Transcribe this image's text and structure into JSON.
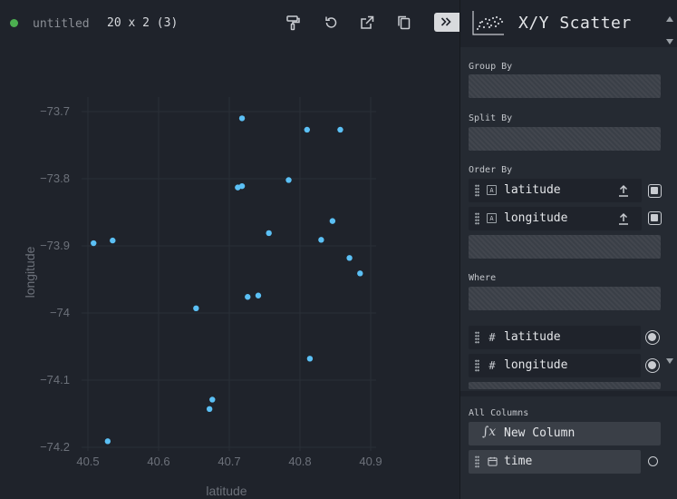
{
  "toolbar": {
    "title": "untitled",
    "dimensions": "20 x 2 (3)",
    "icons": [
      "paint-roller-icon",
      "undo-icon",
      "export-icon",
      "copy-icon",
      "collapse-panel-icon"
    ],
    "status_color": "#4caf50"
  },
  "panel": {
    "chart_type_label": "X/Y Scatter",
    "group_by_label": "Group By",
    "split_by_label": "Split By",
    "order_by_label": "Order By",
    "order_by_items": [
      {
        "label": "latitude",
        "type_glyph": "A"
      },
      {
        "label": "longitude",
        "type_glyph": "A"
      }
    ],
    "where_label": "Where",
    "columns": [
      {
        "label": "latitude",
        "type_glyph": "#"
      },
      {
        "label": "longitude",
        "type_glyph": "#"
      }
    ],
    "all_columns_label": "All Columns",
    "new_column_label": "New Column",
    "extra_columns": [
      {
        "label": "time"
      }
    ]
  },
  "chart_data": {
    "type": "scatter",
    "xlabel": "latitude",
    "ylabel": "longitude",
    "xlim": [
      40.45,
      40.95
    ],
    "ylim": [
      -74.22,
      -73.68
    ],
    "xticks": [
      40.5,
      40.6,
      40.7,
      40.8,
      40.9
    ],
    "yticks": [
      -73.7,
      -73.8,
      -73.9,
      -74,
      -74.1,
      -74.2
    ],
    "xtick_labels": [
      "40.5",
      "40.6",
      "40.7",
      "40.8",
      "40.9"
    ],
    "ytick_labels": [
      "−73.7",
      "−73.8",
      "−73.9",
      "−74",
      "−74.1",
      "−74.2"
    ],
    "point_color": "#5bc0f5",
    "grid": true,
    "x": [
      40.508,
      40.535,
      40.653,
      40.672,
      40.676,
      40.528,
      40.718,
      40.712,
      40.718,
      40.726,
      40.741,
      40.756,
      40.784,
      40.81,
      40.857,
      40.814,
      40.83,
      40.846,
      40.87,
      40.885
    ],
    "y": [
      -73.896,
      -73.892,
      -73.993,
      -74.143,
      -74.129,
      -74.191,
      -73.71,
      -73.813,
      -73.811,
      -73.976,
      -73.974,
      -73.881,
      -73.802,
      -73.727,
      -73.727,
      -74.068,
      -73.891,
      -73.863,
      -73.918,
      -73.941
    ]
  }
}
